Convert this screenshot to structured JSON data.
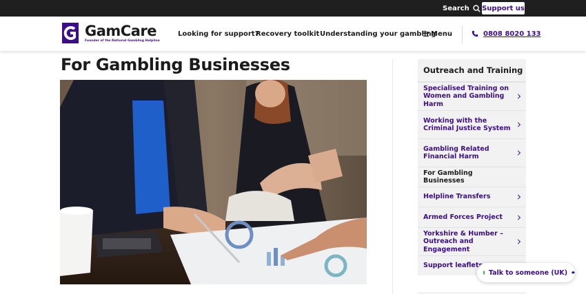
{
  "topbar": {
    "search_label": "Search",
    "support_label": "Support us"
  },
  "header": {
    "logo_name": "GamCare",
    "logo_tagline": "Founder of the National Gambling Helpline",
    "nav": [
      "Looking for support?",
      "Recovery toolkit",
      "Understanding your gambling"
    ],
    "menu_label": "Menu",
    "phone": "0808 8020 133"
  },
  "main": {
    "title": "For Gambling Businesses"
  },
  "sidebar": {
    "heading": "Outreach and Training",
    "items": [
      {
        "label": "Specialised Training on Women and Gambling Harm"
      },
      {
        "label": "Working with the Criminal Justice System"
      },
      {
        "label": "Gambling Related Financial Harm"
      },
      {
        "label": "For Gambling Businesses"
      },
      {
        "label": "Helpline Transfers"
      },
      {
        "label": "Armed Forces Project"
      },
      {
        "label": "Yorkshire & Humber – Outreach and Engagement"
      },
      {
        "label": "Support leaflets"
      }
    ]
  },
  "chat": {
    "label": "Talk to someone (UK)"
  },
  "colors": {
    "brand_purple": "#3b0d8a",
    "topbar_bg": "#1f1f1f",
    "online_green": "#2db34a"
  },
  "icons": {
    "search": "search-icon",
    "menu": "hamburger-icon",
    "phone": "phone-icon",
    "chevron": "chevron-right-icon",
    "chat": "chat-bubble-icon"
  }
}
